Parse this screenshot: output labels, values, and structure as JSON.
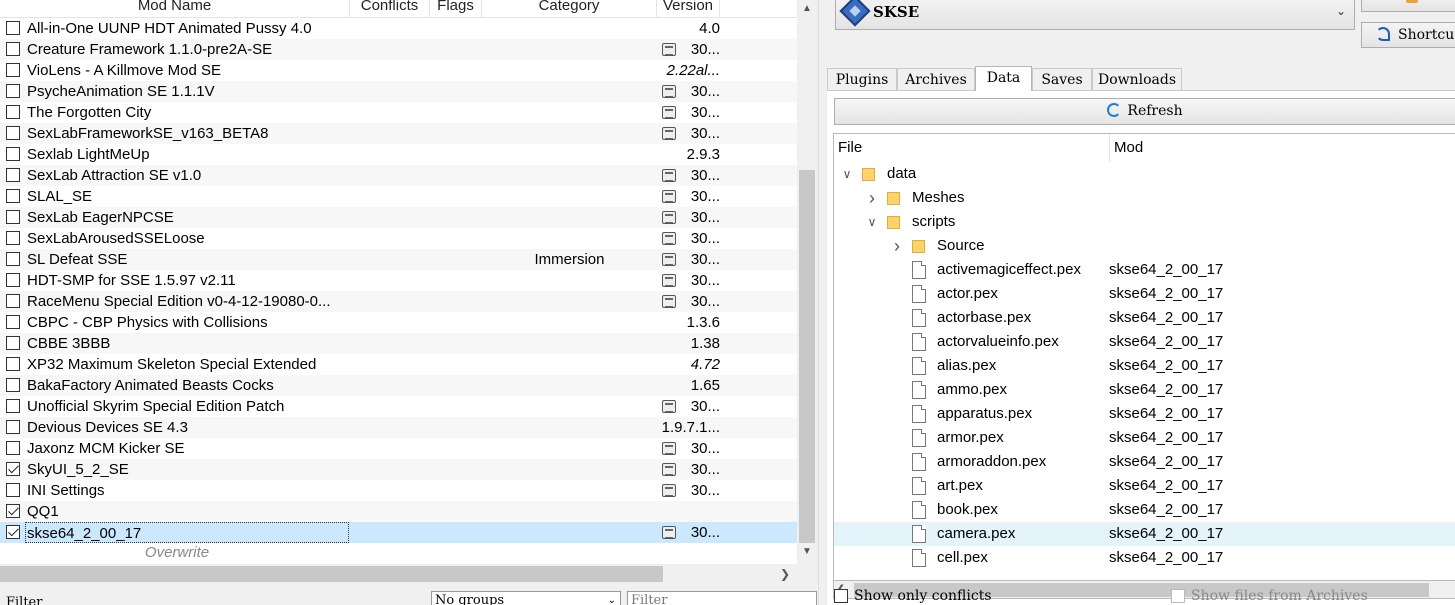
{
  "modlist": {
    "columns": {
      "name": "Mod Name",
      "conflicts": "Conflicts",
      "flags": "Flags",
      "category": "Category",
      "version": "Version"
    },
    "rows": [
      {
        "name": "All-in-One UUNP HDT Animated Pussy 4.0",
        "checked": false,
        "category": "",
        "nexus": false,
        "version": "4.0",
        "italic": false
      },
      {
        "name": "Creature Framework 1.1.0-pre2A-SE",
        "checked": false,
        "category": "",
        "nexus": true,
        "version": "30...",
        "italic": false
      },
      {
        "name": "VioLens - A Killmove Mod SE",
        "checked": false,
        "category": "",
        "nexus": false,
        "version": "2.22al...",
        "italic": true
      },
      {
        "name": "PsycheAnimation SE 1.1.1V",
        "checked": false,
        "category": "",
        "nexus": true,
        "version": "30...",
        "italic": false
      },
      {
        "name": "The Forgotten City",
        "checked": false,
        "category": "",
        "nexus": true,
        "version": "30...",
        "italic": false
      },
      {
        "name": "SexLabFrameworkSE_v163_BETA8",
        "checked": false,
        "category": "",
        "nexus": true,
        "version": "30...",
        "italic": false
      },
      {
        "name": "Sexlab LightMeUp",
        "checked": false,
        "category": "",
        "nexus": false,
        "version": "2.9.3",
        "italic": false
      },
      {
        "name": "SexLab Attraction SE v1.0",
        "checked": false,
        "category": "",
        "nexus": true,
        "version": "30...",
        "italic": false
      },
      {
        "name": "SLAL_SE",
        "checked": false,
        "category": "",
        "nexus": true,
        "version": "30...",
        "italic": false
      },
      {
        "name": "SexLab EagerNPCSE",
        "checked": false,
        "category": "",
        "nexus": true,
        "version": "30...",
        "italic": false
      },
      {
        "name": "SexLabArousedSSELoose",
        "checked": false,
        "category": "",
        "nexus": true,
        "version": "30...",
        "italic": false
      },
      {
        "name": "SL Defeat SSE",
        "checked": false,
        "category": "Immersion",
        "nexus": true,
        "version": "30...",
        "italic": false
      },
      {
        "name": "HDT-SMP for SSE 1.5.97 v2.11",
        "checked": false,
        "category": "",
        "nexus": true,
        "version": "30...",
        "italic": false
      },
      {
        "name": "RaceMenu Special Edition v0-4-12-19080-0...",
        "checked": false,
        "category": "",
        "nexus": true,
        "version": "30...",
        "italic": false
      },
      {
        "name": "CBPC - CBP Physics with Collisions",
        "checked": false,
        "category": "",
        "nexus": false,
        "version": "1.3.6",
        "italic": false
      },
      {
        "name": "CBBE 3BBB",
        "checked": false,
        "category": "",
        "nexus": false,
        "version": "1.38",
        "italic": false
      },
      {
        "name": "XP32 Maximum Skeleton Special Extended",
        "checked": false,
        "category": "",
        "nexus": false,
        "version": "4.72",
        "italic": true
      },
      {
        "name": "BakaFactory Animated Beasts Cocks",
        "checked": false,
        "category": "",
        "nexus": false,
        "version": "1.65",
        "italic": false
      },
      {
        "name": "Unofficial Skyrim Special Edition Patch",
        "checked": false,
        "category": "",
        "nexus": true,
        "version": "30...",
        "italic": false
      },
      {
        "name": "Devious Devices SE 4.3",
        "checked": false,
        "category": "",
        "nexus": false,
        "version": "1.9.7.1...",
        "italic": false
      },
      {
        "name": "Jaxonz MCM Kicker SE",
        "checked": false,
        "category": "",
        "nexus": true,
        "version": "30...",
        "italic": false
      },
      {
        "name": "SkyUI_5_2_SE",
        "checked": true,
        "category": "",
        "nexus": true,
        "version": "30...",
        "italic": false
      },
      {
        "name": "INI Settings",
        "checked": false,
        "category": "",
        "nexus": true,
        "version": "30...",
        "italic": false
      },
      {
        "name": "QQ1",
        "checked": true,
        "category": "",
        "nexus": false,
        "version": "",
        "italic": false
      },
      {
        "name": "skse64_2_00_17",
        "checked": true,
        "category": "",
        "nexus": true,
        "version": "30...",
        "italic": false,
        "selected": true
      }
    ],
    "overwrite_label": "Overwrite"
  },
  "filterbar": {
    "label": "Filter",
    "groups_value": "No groups",
    "filter_placeholder": "Filter"
  },
  "executable": {
    "label": "SKSE"
  },
  "side_buttons": {
    "shortcut_label": "Shortcut"
  },
  "tabs": [
    "Plugins",
    "Archives",
    "Data",
    "Saves",
    "Downloads"
  ],
  "active_tab": "Data",
  "data_tab": {
    "refresh_label": "Refresh",
    "columns": {
      "file": "File",
      "mod": "Mod"
    },
    "tree": [
      {
        "name": "data",
        "type": "folder",
        "depth": 0,
        "expanded": true,
        "mod": ""
      },
      {
        "name": "Meshes",
        "type": "folder",
        "depth": 1,
        "expanded": false,
        "mod": ""
      },
      {
        "name": "scripts",
        "type": "folder",
        "depth": 1,
        "expanded": true,
        "mod": ""
      },
      {
        "name": "Source",
        "type": "folder",
        "depth": 2,
        "expanded": false,
        "mod": ""
      },
      {
        "name": "activemagiceffect.pex",
        "type": "file",
        "depth": 2,
        "mod": "skse64_2_00_17"
      },
      {
        "name": "actor.pex",
        "type": "file",
        "depth": 2,
        "mod": "skse64_2_00_17"
      },
      {
        "name": "actorbase.pex",
        "type": "file",
        "depth": 2,
        "mod": "skse64_2_00_17"
      },
      {
        "name": "actorvalueinfo.pex",
        "type": "file",
        "depth": 2,
        "mod": "skse64_2_00_17"
      },
      {
        "name": "alias.pex",
        "type": "file",
        "depth": 2,
        "mod": "skse64_2_00_17"
      },
      {
        "name": "ammo.pex",
        "type": "file",
        "depth": 2,
        "mod": "skse64_2_00_17"
      },
      {
        "name": "apparatus.pex",
        "type": "file",
        "depth": 2,
        "mod": "skse64_2_00_17"
      },
      {
        "name": "armor.pex",
        "type": "file",
        "depth": 2,
        "mod": "skse64_2_00_17"
      },
      {
        "name": "armoraddon.pex",
        "type": "file",
        "depth": 2,
        "mod": "skse64_2_00_17"
      },
      {
        "name": "art.pex",
        "type": "file",
        "depth": 2,
        "mod": "skse64_2_00_17"
      },
      {
        "name": "book.pex",
        "type": "file",
        "depth": 2,
        "mod": "skse64_2_00_17"
      },
      {
        "name": "camera.pex",
        "type": "file",
        "depth": 2,
        "mod": "skse64_2_00_17",
        "selected": true
      },
      {
        "name": "cell.pex",
        "type": "file",
        "depth": 2,
        "mod": "skse64_2_00_17"
      }
    ],
    "show_only_conflicts": "Show only conflicts",
    "show_files_from_archives": "Show files from Archives"
  }
}
